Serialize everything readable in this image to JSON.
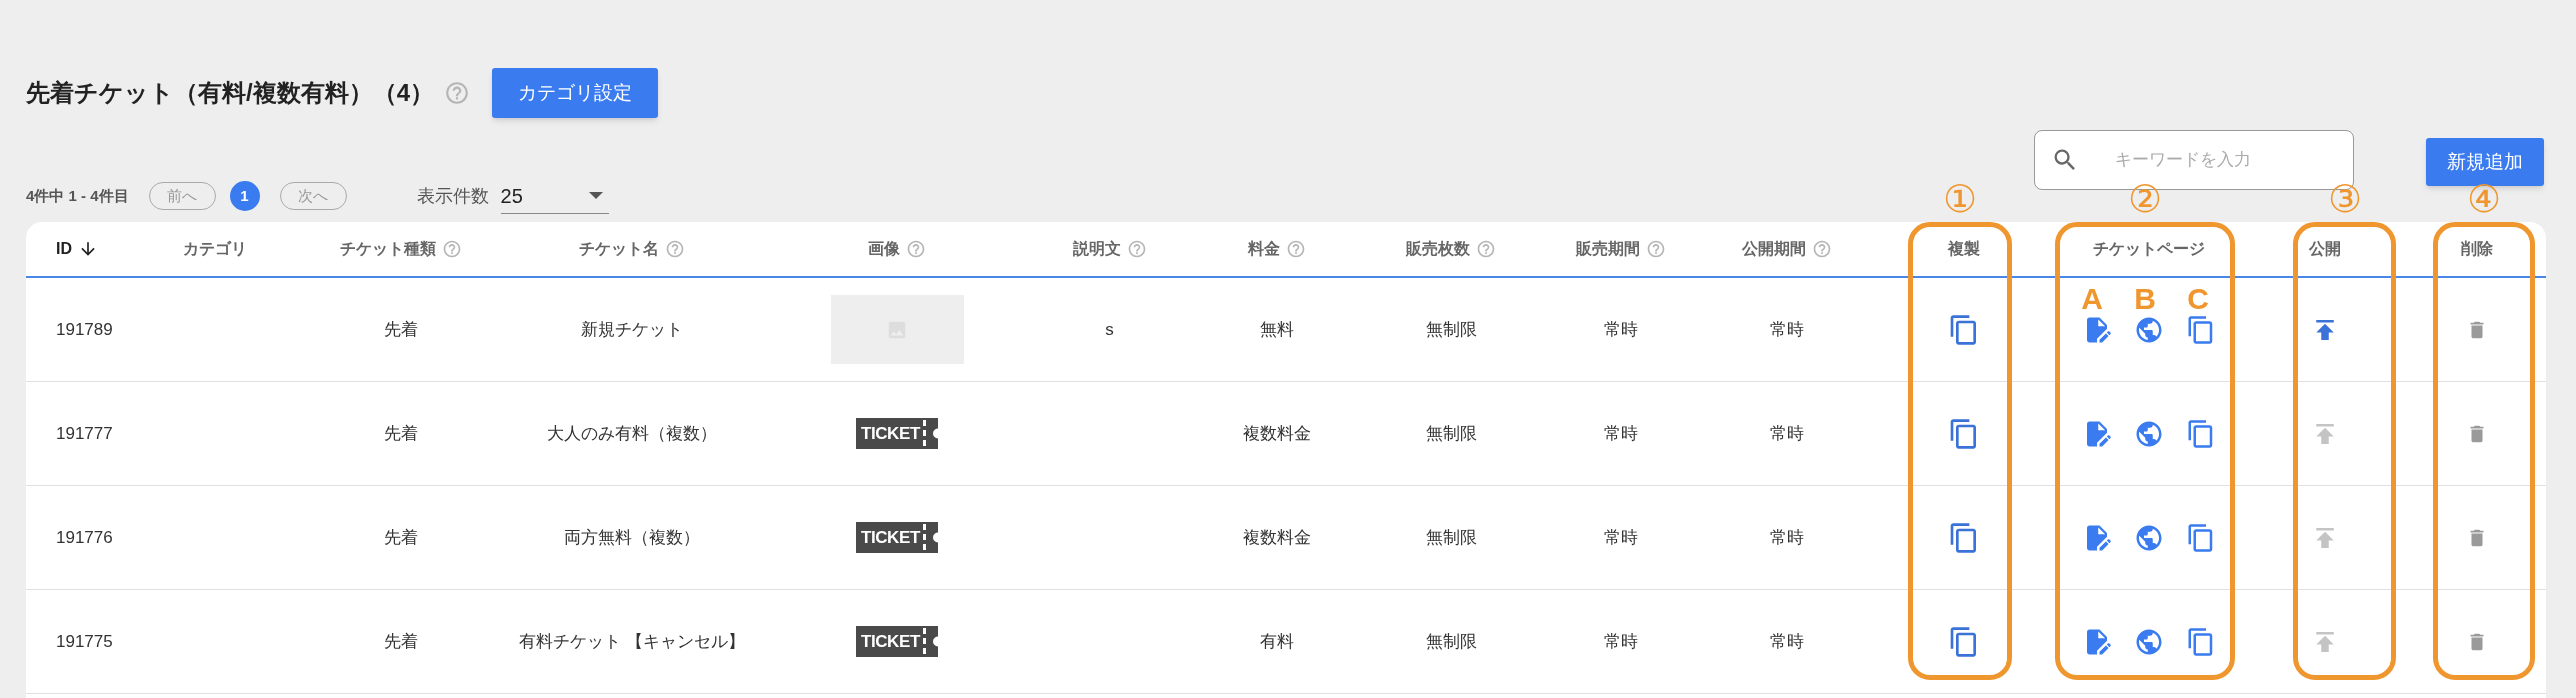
{
  "title": {
    "text": "先着チケット（有料/複数有料）（4）",
    "category_button": "カテゴリ設定"
  },
  "pagination": {
    "range": "4件中 1 - 4件目",
    "prev": "前へ",
    "current": "1",
    "next": "次へ",
    "per_page_label": "表示件数",
    "per_page": "25"
  },
  "search": {
    "placeholder": "キーワードを入力"
  },
  "add_button": "新規追加",
  "table": {
    "columns": [
      {
        "label": "ID",
        "sorted": true,
        "help": false
      },
      {
        "label": "カテゴリ",
        "help": false
      },
      {
        "label": "チケット種類",
        "help": true
      },
      {
        "label": "チケット名",
        "help": true
      },
      {
        "label": "画像",
        "help": true
      },
      {
        "label": "説明文",
        "help": true
      },
      {
        "label": "料金",
        "help": true
      },
      {
        "label": "販売枚数",
        "help": true
      },
      {
        "label": "販売期間",
        "help": true
      },
      {
        "label": "公開期間",
        "help": true
      },
      {
        "label": "複製",
        "help": false
      },
      {
        "label": "チケットページ",
        "help": false
      },
      {
        "label": "公開",
        "help": false
      },
      {
        "label": "削除",
        "help": false
      }
    ],
    "rows": [
      {
        "id": "191789",
        "type": "先着",
        "name": "新規チケット",
        "image": {
          "kind": "placeholder"
        },
        "description": "s",
        "price": "無料",
        "quantity": "無制限",
        "sale_period": "常時",
        "public_period": "常時",
        "published": true
      },
      {
        "id": "191777",
        "type": "先着",
        "name": "大人のみ有料（複数）",
        "image": {
          "kind": "ticket",
          "label": "TICKET"
        },
        "price": "複数料金",
        "quantity": "無制限",
        "sale_period": "常時",
        "public_period": "常時",
        "published": false
      },
      {
        "id": "191776",
        "type": "先着",
        "name": "両方無料（複数）",
        "image": {
          "kind": "ticket",
          "label": "TICKET"
        },
        "price": "複数料金",
        "quantity": "無制限",
        "sale_period": "常時",
        "public_period": "常時",
        "published": false
      },
      {
        "id": "191775",
        "type": "先着",
        "name": "有料チケット 【キャンセル】",
        "image": {
          "kind": "ticket",
          "label": "TICKET"
        },
        "price": "有料",
        "quantity": "無制限",
        "sale_period": "常時",
        "public_period": "常時",
        "published": false
      }
    ]
  },
  "annotations": [
    {
      "label": "①"
    },
    {
      "label": "②",
      "letters": [
        "A",
        "B",
        "C"
      ]
    },
    {
      "label": "③"
    },
    {
      "label": "④"
    }
  ]
}
